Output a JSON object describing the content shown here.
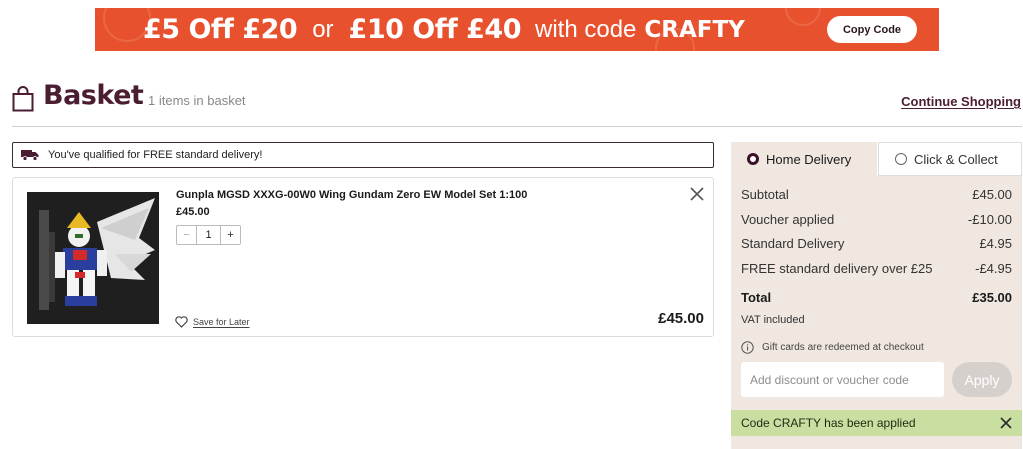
{
  "banner": {
    "offer_one": "£5 Off £20",
    "or_text": "or",
    "offer_two": "£10 Off £40",
    "with_code_text": "with code",
    "code": "CRAFTY",
    "copy_button": "Copy Code",
    "color": "#e8512e"
  },
  "header": {
    "title": "Basket",
    "item_count": "1 items in basket",
    "continue_shopping": "Continue Shopping",
    "title_color": "#4a1d33"
  },
  "notice": {
    "text": "You've qualified for FREE standard delivery!",
    "icon": "truck-icon"
  },
  "item": {
    "name": "Gunpla MGSD XXXG-00W0 Wing Gundam Zero EW Model Set 1:100",
    "price": "£45.00",
    "quantity": "1",
    "minus": "−",
    "plus": "+",
    "save_later": "Save for Later",
    "line_total": "£45.00"
  },
  "delivery_tabs": [
    {
      "label": "Home Delivery",
      "selected": true
    },
    {
      "label": "Click & Collect",
      "selected": false
    }
  ],
  "summary": {
    "rows": [
      {
        "label": "Subtotal",
        "value": "£45.00"
      },
      {
        "label": "Voucher applied",
        "value": "-£10.00"
      },
      {
        "label": "Standard Delivery",
        "value": "£4.95"
      },
      {
        "label": "FREE standard delivery over £25",
        "value": "-£4.95"
      }
    ],
    "total_label": "Total",
    "total_value": "£35.00",
    "vat": "VAT included",
    "gift_note": "Gift cards are redeemed at checkout",
    "voucher_placeholder": "Add discount or voucher code",
    "apply_button": "Apply",
    "applied_message": "Code CRAFTY has been applied",
    "panel_color": "#efe7e0",
    "applied_color": "#c9dfa2"
  }
}
